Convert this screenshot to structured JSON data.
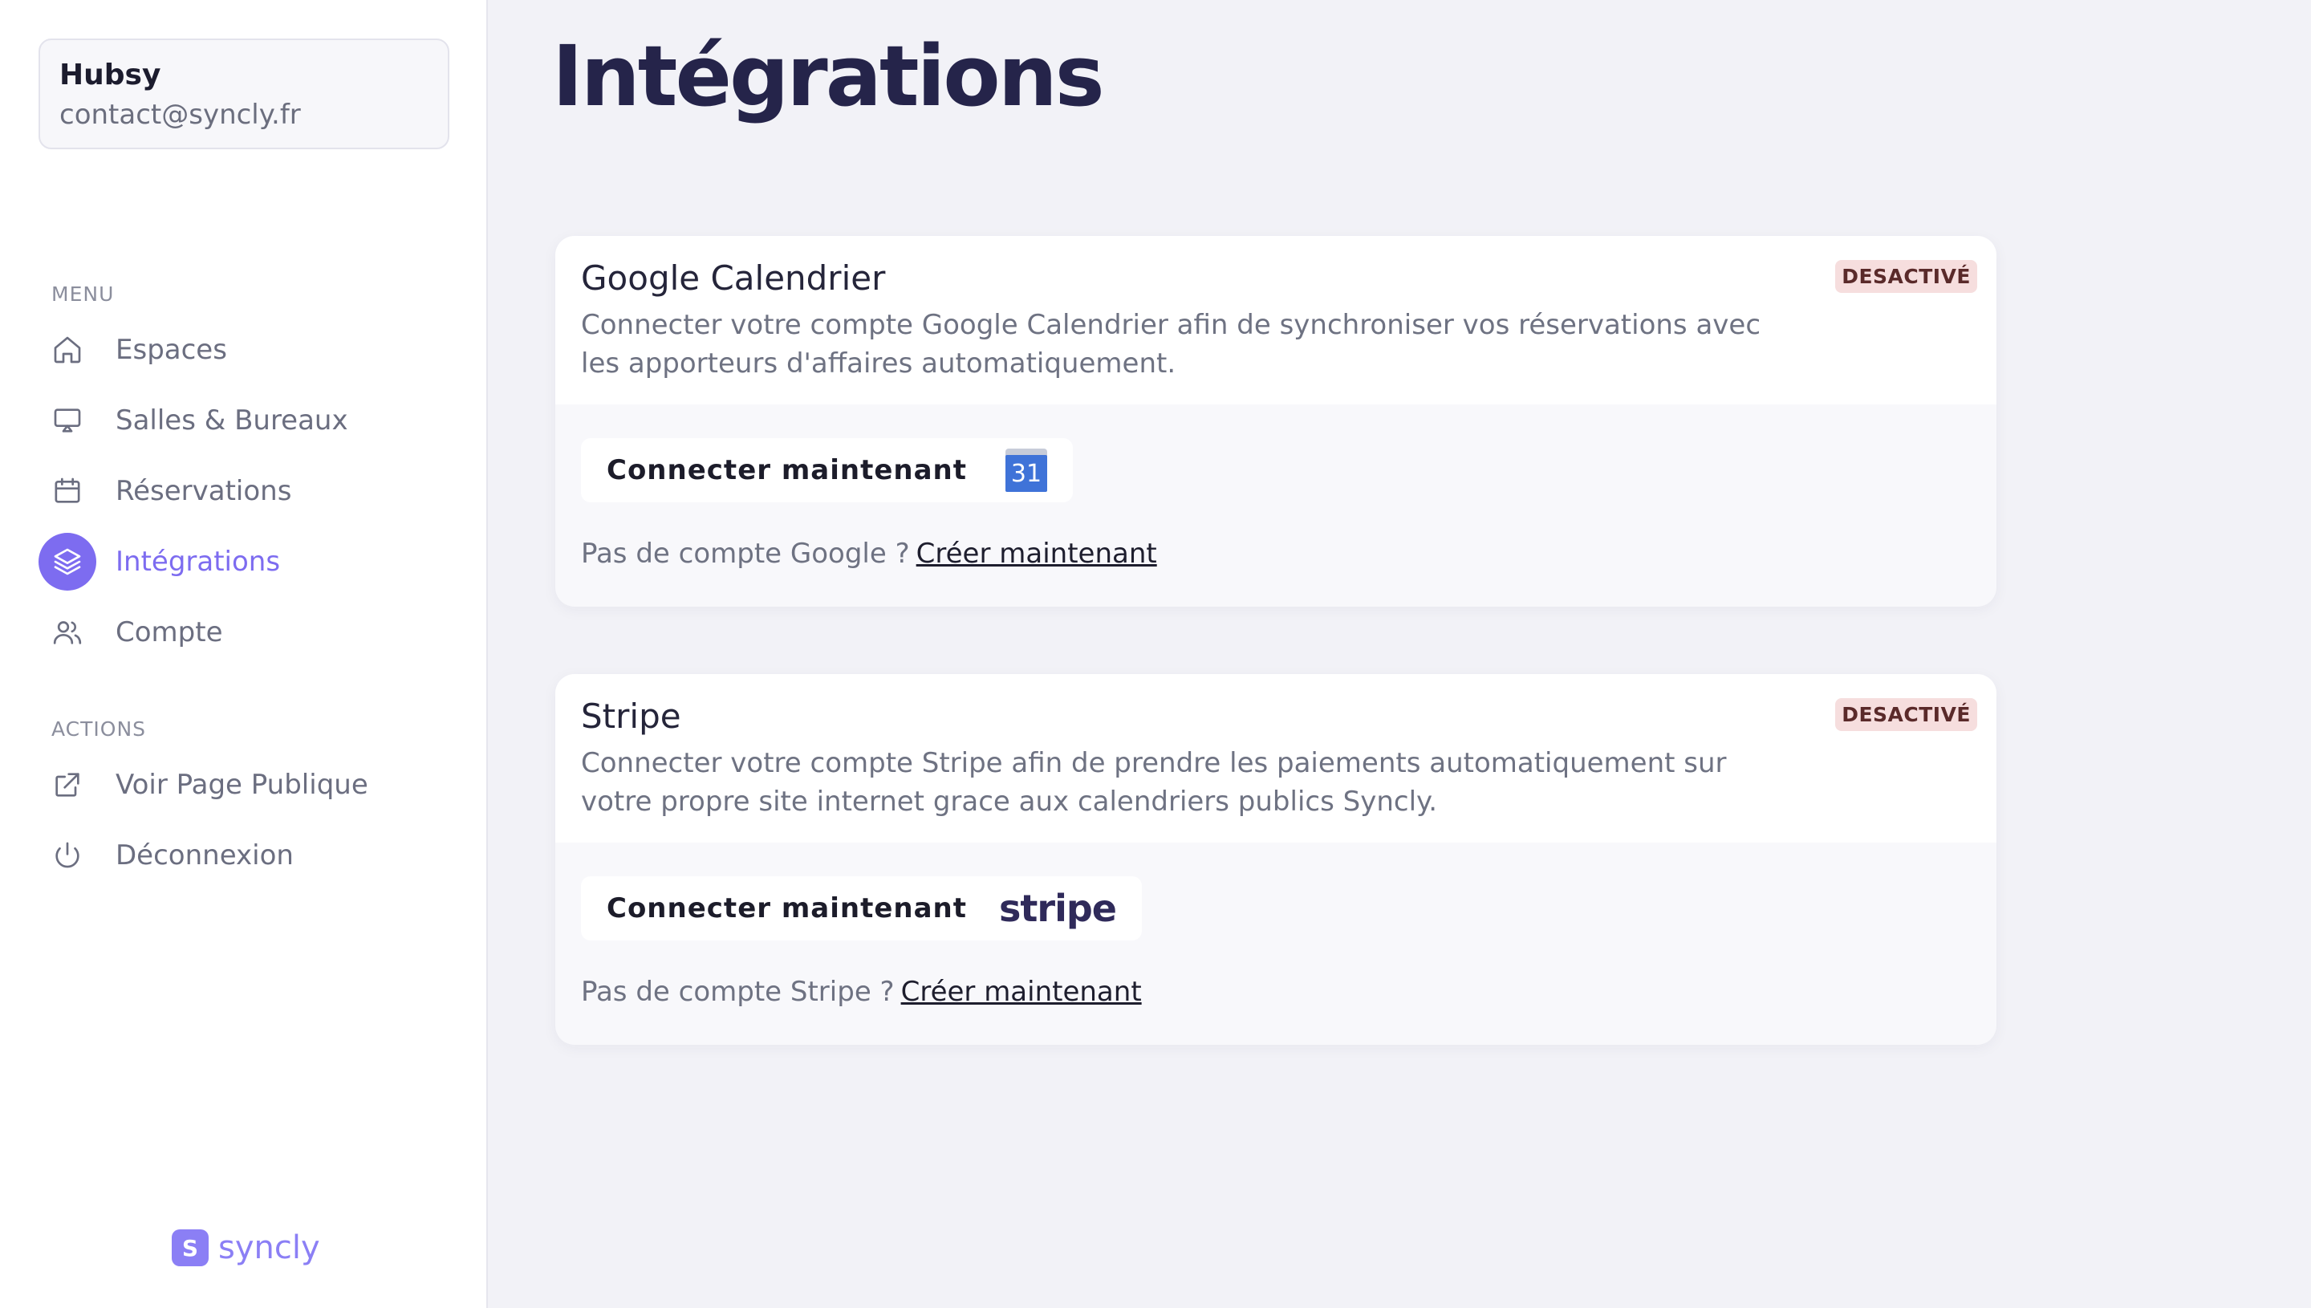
{
  "account": {
    "name": "Hubsy",
    "email": "contact@syncly.fr"
  },
  "sidebar": {
    "menu_label": "MENU",
    "menu_items": [
      {
        "label": "Espaces",
        "icon": "home-icon"
      },
      {
        "label": "Salles & Bureaux",
        "icon": "screen-icon"
      },
      {
        "label": "Réservations",
        "icon": "calendar-icon"
      },
      {
        "label": "Intégrations",
        "icon": "layers-icon",
        "active": true
      },
      {
        "label": "Compte",
        "icon": "users-icon"
      }
    ],
    "actions_label": "ACTIONS",
    "action_items": [
      {
        "label": "Voir Page Publique",
        "icon": "external-link-icon"
      },
      {
        "label": "Déconnexion",
        "icon": "power-icon"
      }
    ]
  },
  "brand": {
    "logo_letter": "S",
    "name": "syncly"
  },
  "main": {
    "title": "Intégrations",
    "integrations": [
      {
        "title": "Google Calendrier",
        "status": "DESACTIVÉ",
        "description": "Connecter votre compte Google Calendrier afin de synchroniser vos réservations avec les apporteurs d'affaires automatiquement.",
        "connect_label": "Connecter maintenant",
        "logo_text": "31",
        "no_account_text": "Pas de compte Google ?",
        "create_link": "Créer maintenant"
      },
      {
        "title": "Stripe",
        "status": "DESACTIVÉ",
        "description": "Connecter votre compte Stripe afin de prendre les paiements automatiquement sur votre propre site internet grace aux calendriers publics Syncly.",
        "connect_label": "Connecter maintenant",
        "logo_text": "stripe",
        "no_account_text": "Pas de compte Stripe ?",
        "create_link": "Créer maintenant"
      }
    ]
  },
  "colors": {
    "accent": "#7d6cf0",
    "badge_bg": "#f6dede",
    "title": "#25244a"
  }
}
